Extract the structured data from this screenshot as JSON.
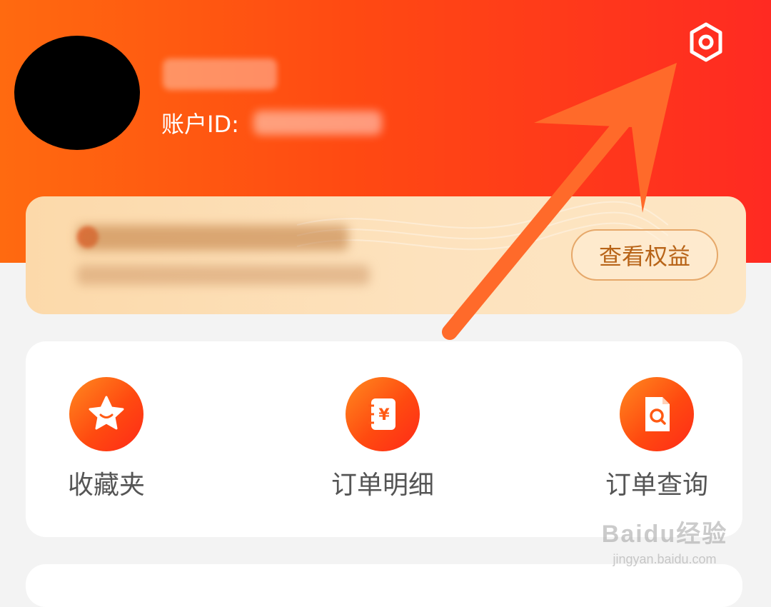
{
  "profile": {
    "account_label": "账户ID:"
  },
  "member_card": {
    "button_label": "查看权益"
  },
  "services": [
    {
      "label": "收藏夹",
      "icon": "star-smile-icon"
    },
    {
      "label": "订单明细",
      "icon": "ledger-yen-icon"
    },
    {
      "label": "订单查询",
      "icon": "document-search-icon"
    }
  ],
  "watermark": {
    "main": "Baidu经验",
    "url": "jingyan.baidu.com"
  },
  "colors": {
    "header_start": "#ff6a10",
    "header_end": "#ff2a22",
    "accent": "#ff4a10",
    "annotation_arrow": "#ff6a2a",
    "member_button_text": "#b86418"
  }
}
